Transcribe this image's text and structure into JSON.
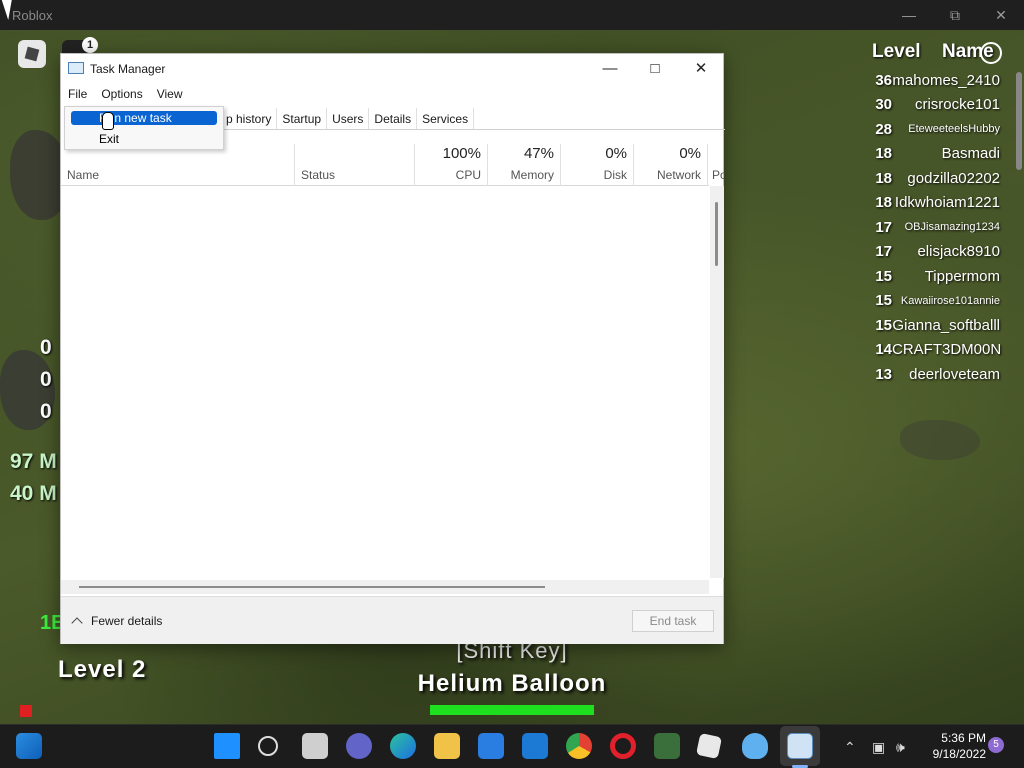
{
  "window": {
    "title": "Roblox"
  },
  "game": {
    "chat_badge": "1",
    "stats_left": [
      "0",
      "0",
      "0"
    ],
    "stats_green": [
      "97 M",
      "40 M"
    ],
    "green_digits": "1E",
    "level_label": "Level 2",
    "shift_key": "[Shift Key]",
    "item_name": "Helium Balloon",
    "item_bar_fraction": 1.0
  },
  "leaderboard": {
    "header_level": "Level",
    "header_name": "Name",
    "rows": [
      {
        "level": "36",
        "name": "mahomes_2410",
        "small": false
      },
      {
        "level": "30",
        "name": "crisrocke101",
        "small": false
      },
      {
        "level": "28",
        "name": "EteweeteelsHubby",
        "small": true
      },
      {
        "level": "18",
        "name": "Basmadi",
        "small": false
      },
      {
        "level": "18",
        "name": "godzilla02202",
        "small": false
      },
      {
        "level": "18",
        "name": "Idkwhoiam1221",
        "small": false
      },
      {
        "level": "17",
        "name": "OBJisamazing1234",
        "small": true
      },
      {
        "level": "17",
        "name": "elisjack8910",
        "small": false
      },
      {
        "level": "15",
        "name": "Tippermom",
        "small": false
      },
      {
        "level": "15",
        "name": "Kawaiirose101annie",
        "small": true
      },
      {
        "level": "15",
        "name": "Gianna_softballl",
        "small": false
      },
      {
        "level": "14",
        "name": "CRAFT3DM00N",
        "small": false
      },
      {
        "level": "13",
        "name": "deerloveteam",
        "small": false
      }
    ]
  },
  "task_manager": {
    "title": "Task Manager",
    "menu": [
      "File",
      "Options",
      "View"
    ],
    "file_menu": [
      "Run new task",
      "Exit"
    ],
    "tabs": [
      "p history",
      "Startup",
      "Users",
      "Details",
      "Services"
    ],
    "columns": {
      "name": "Name",
      "status": "Status",
      "cpu": {
        "pct": "100%",
        "label": "CPU"
      },
      "memory": {
        "pct": "47%",
        "label": "Memory"
      },
      "disk": {
        "pct": "0%",
        "label": "Disk"
      },
      "network": {
        "pct": "0%",
        "label": "Network"
      },
      "power": "Po"
    },
    "fewer_details": "Fewer details",
    "end_task": "End task"
  },
  "taskbar": {
    "time": "5:36 PM",
    "date": "9/18/2022",
    "notification_count": "5"
  }
}
